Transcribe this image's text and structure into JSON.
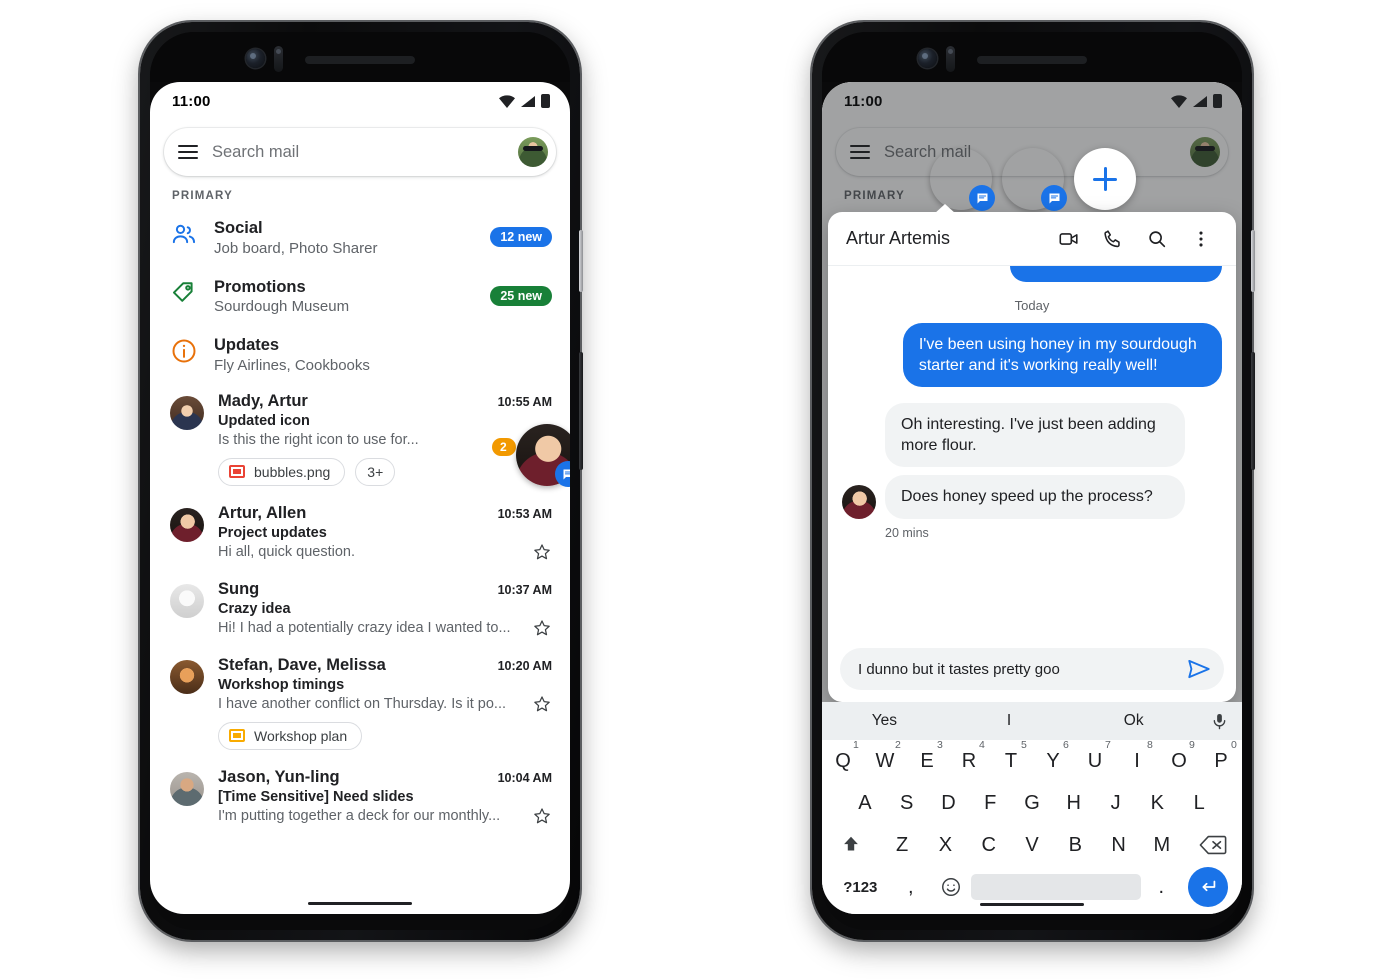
{
  "accent": {
    "blue": "#1a73e8",
    "green": "#188038",
    "orange": "#f29900",
    "red": "#ea4335",
    "yellow": "#f9ab00"
  },
  "left_phone": {
    "status": {
      "time": "11:00",
      "wifi_icon": "wifi-icon",
      "signal_icon": "signal-icon",
      "battery_icon": "battery-icon"
    },
    "search": {
      "menu_icon": "hamburger-menu-icon",
      "placeholder": "Search mail",
      "avatar_icon": "account-avatar"
    },
    "section_label": "PRIMARY",
    "categories": [
      {
        "icon": "social-people-icon",
        "title": "Social",
        "subtitle": "Job board, Photo Sharer",
        "badge": "12 new",
        "badge_color": "blue"
      },
      {
        "icon": "promotions-tag-icon",
        "title": "Promotions",
        "subtitle": "Sourdough Museum",
        "badge": "25 new",
        "badge_color": "green"
      },
      {
        "icon": "updates-info-icon",
        "title": "Updates",
        "subtitle": "Fly Airlines, Cookbooks",
        "badge": "",
        "badge_color": "none"
      }
    ],
    "floating_bubble": {
      "unread_count": "2",
      "chat_badge_icon": "message-bubble-icon",
      "avatar": "artur-avatar"
    },
    "mails": [
      {
        "avatar": "mady-avatar",
        "from": "Mady, Artur",
        "time": "10:55 AM",
        "subject": "Updated icon",
        "snippet": "Is this the right icon to use for...",
        "star_icon": "star-outline-icon",
        "chips": [
          {
            "icon": "image-file-icon",
            "label": "bubbles.png"
          },
          {
            "icon": "",
            "label": "3+"
          }
        ]
      },
      {
        "avatar": "artur-avatar",
        "from": "Artur, Allen",
        "time": "10:53 AM",
        "subject": "Project updates",
        "snippet": "Hi all, quick question.",
        "star_icon": "star-outline-icon",
        "chips": []
      },
      {
        "avatar": "sung-avatar",
        "from": "Sung",
        "time": "10:37 AM",
        "subject": "Crazy idea",
        "snippet": "Hi! I had a potentially crazy idea I wanted to...",
        "star_icon": "star-outline-icon",
        "chips": []
      },
      {
        "avatar": "stefan-avatar",
        "from": "Stefan, Dave, Melissa",
        "time": "10:20 AM",
        "subject": "Workshop timings",
        "snippet": "I have another conflict on Thursday. Is it po...",
        "star_icon": "star-outline-icon",
        "chips": [
          {
            "icon": "slides-file-icon",
            "label": "Workshop plan"
          }
        ]
      },
      {
        "avatar": "jason-avatar",
        "from": "Jason, Yun-ling",
        "time": "10:04 AM",
        "subject": "[Time Sensitive] Need slides",
        "snippet": "I'm putting together a deck for our monthly...",
        "star_icon": "star-outline-icon",
        "chips": []
      }
    ]
  },
  "right_phone": {
    "status": {
      "time": "11:00",
      "wifi_icon": "wifi-icon",
      "signal_icon": "signal-icon",
      "battery_icon": "battery-icon"
    },
    "background": {
      "search_placeholder": "Search mail",
      "menu_icon": "hamburger-menu-icon",
      "section_label": "PRIMARY",
      "avatar_icon": "account-avatar"
    },
    "bubbles": [
      {
        "name": "artur-bubble",
        "badge_icon": "message-bubble-icon",
        "selected": true
      },
      {
        "name": "mady-bubble",
        "badge_icon": "message-bubble-icon",
        "selected": false
      }
    ],
    "add_bubble": {
      "icon": "plus-icon",
      "label": ""
    },
    "chat": {
      "contact_name": "Artur Artemis",
      "actions": [
        {
          "name": "video-call-icon"
        },
        {
          "name": "phone-call-icon"
        },
        {
          "name": "search-icon"
        },
        {
          "name": "more-vert-icon"
        }
      ],
      "day_divider": "Today",
      "messages": [
        {
          "direction": "out",
          "text": "I've been using honey in my sourdough starter and it's working really well!"
        },
        {
          "direction": "in",
          "text": "Oh interesting. I've just been adding more flour."
        },
        {
          "direction": "in",
          "text": "Does honey speed up the process?"
        }
      ],
      "timestamp": "20 mins",
      "composer": {
        "value": "I dunno but it tastes pretty goo",
        "send_icon": "send-icon"
      }
    },
    "keyboard": {
      "suggestions": [
        "Yes",
        "I",
        "Ok"
      ],
      "mic_icon": "microphone-icon",
      "row1": [
        {
          "key": "Q",
          "num": "1"
        },
        {
          "key": "W",
          "num": "2"
        },
        {
          "key": "E",
          "num": "3"
        },
        {
          "key": "R",
          "num": "4"
        },
        {
          "key": "T",
          "num": "5"
        },
        {
          "key": "Y",
          "num": "6"
        },
        {
          "key": "U",
          "num": "7"
        },
        {
          "key": "I",
          "num": "8"
        },
        {
          "key": "O",
          "num": "9"
        },
        {
          "key": "P",
          "num": "0"
        }
      ],
      "row2": [
        "A",
        "S",
        "D",
        "F",
        "G",
        "H",
        "J",
        "K",
        "L"
      ],
      "row3": [
        "Z",
        "X",
        "C",
        "V",
        "B",
        "N",
        "M"
      ],
      "shift_icon": "shift-up-icon",
      "backspace_icon": "backspace-icon",
      "symbols_key": "?123",
      "comma_key": ",",
      "emoji_icon": "emoji-smiley-icon",
      "space_key": "",
      "period_key": ".",
      "enter_icon": "enter-return-icon"
    }
  }
}
